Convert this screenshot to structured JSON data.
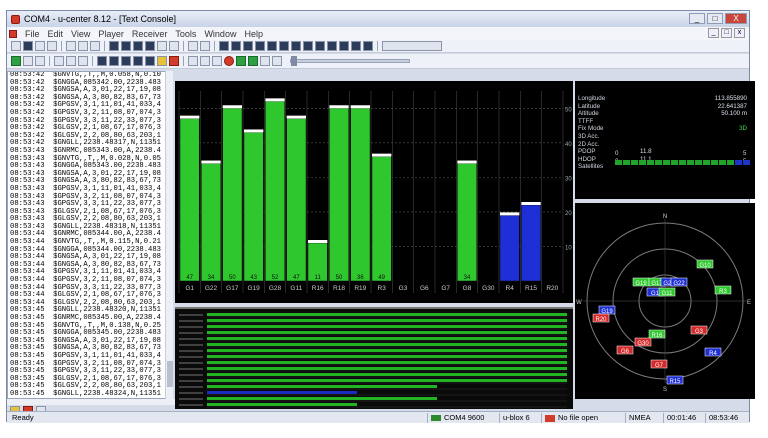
{
  "window": {
    "title": "COM4 - u-center 8.12 - [Text Console]",
    "buttons": [
      "_",
      "□",
      "X"
    ]
  },
  "menu": [
    "File",
    "Edit",
    "View",
    "Player",
    "Receiver",
    "Tools",
    "Window",
    "Help"
  ],
  "console_lines": [
    "08:53:42  $GNVTG,,T,,M,0.058,N,0.10",
    "08:53:42  $GNGGA,085342.00,2238.483",
    "08:53:42  $GNGSA,A,3,01,22,17,19,08",
    "08:53:42  $GNGSA,A,3,80,82,83,67,73",
    "08:53:42  $GPGSV,3,1,11,01,41,033,4",
    "08:53:42  $GPGSV,3,2,11,08,07,074,3",
    "08:53:42  $GPGSV,3,3,11,22,33,077,3",
    "08:53:42  $GLGSV,2,1,08,67,17,076,3",
    "08:53:42  $GLGSV,2,2,08,80,63,203,1",
    "08:53:42  $GNGLL,2238.48317,N,11351",
    "08:53:43  $GNRMC,085343.00,A,2238.4",
    "08:53:43  $GNVTG,,T,,M,0.028,N,0.05",
    "08:53:43  $GNGGA,085343.00,2238.483",
    "08:53:43  $GNGSA,A,3,01,22,17,19,08",
    "08:53:43  $GNGSA,A,3,80,82,83,67,73",
    "08:53:43  $GPGSV,3,1,11,01,41,033,4",
    "08:53:43  $GPGSV,3,2,11,08,07,074,3",
    "08:53:43  $GPGSV,3,3,11,22,33,077,3",
    "08:53:43  $GLGSV,2,1,08,67,17,076,3",
    "08:53:43  $GLGSV,2,2,08,80,63,203,1",
    "08:53:43  $GNGLL,2238.48318,N,11351",
    "08:53:44  $GNRMC,085344.00,A,2238.4",
    "08:53:44  $GNVTG,,T,,M,0.115,N,0.21",
    "08:53:44  $GNGGA,085344.00,2238.483",
    "08:53:44  $GNGSA,A,3,01,22,17,19,08",
    "08:53:44  $GNGSA,A,3,80,82,83,67,73",
    "08:53:44  $GPGSV,3,1,11,01,41,033,4",
    "08:53:44  $GPGSV,3,2,11,08,07,074,3",
    "08:53:44  $GPGSV,3,3,11,22,33,077,3",
    "08:53:44  $GLGSV,2,1,08,67,17,076,3",
    "08:53:44  $GLGSV,2,2,08,80,63,203,1",
    "08:53:45  $GNGLL,2238.48320,N,11351",
    "08:53:45  $GNRMC,085345.00,A,2238.4",
    "08:53:45  $GNVTG,,T,,M,0.138,N,0.25",
    "08:53:45  $GNGGA,085345.00,2238.483",
    "08:53:45  $GNGSA,A,3,01,22,17,19,08",
    "08:53:45  $GNGSA,A,3,80,82,83,67,73",
    "08:53:45  $GPGSV,3,1,11,01,41,033,4",
    "08:53:45  $GPGSV,3,2,11,08,07,074,3",
    "08:53:45  $GPGSV,3,3,11,22,33,077,3",
    "08:53:45  $GLGSV,2,1,08,67,17,076,3",
    "08:53:45  $GLGSV,2,2,08,80,63,203,1",
    "08:53:45  $GNGLL,2238.48324,N,11351"
  ],
  "chart_data": {
    "type": "bar",
    "categories": [
      "G1",
      "G22",
      "G17",
      "G19",
      "G28",
      "G11",
      "R16",
      "R18",
      "R19",
      "R3",
      "G3",
      "G6",
      "G7",
      "G8",
      "G30",
      "R4",
      "R15",
      "R20"
    ],
    "values": [
      47,
      34,
      50,
      43,
      52,
      47,
      11,
      50,
      50,
      36,
      0,
      0,
      0,
      34,
      0,
      19,
      22,
      0
    ],
    "data_labels": [
      "47",
      "34",
      "50",
      "43",
      "52",
      "47",
      "11",
      "50",
      "36",
      "49",
      "",
      "",
      "",
      "34",
      "",
      "",
      "",
      ""
    ],
    "series_colors": {
      "used": "#2ec82e",
      "not_used": "#1e2fd6"
    },
    "colors": [
      "used",
      "used",
      "used",
      "used",
      "used",
      "used",
      "used",
      "used",
      "used",
      "used",
      "used",
      "used",
      "used",
      "used",
      "used",
      "not_used",
      "not_used",
      "used"
    ],
    "ylim": [
      0,
      55
    ],
    "yticks": [
      "50",
      "40",
      "30",
      "20",
      "10"
    ],
    "grid": true
  },
  "dataview": {
    "rows": [
      {
        "label": "Longitude",
        "value": "113.855890"
      },
      {
        "label": "Latitude",
        "value": "22.641387"
      },
      {
        "label": "Altitude",
        "value": "50.100 m"
      },
      {
        "label": "TTFF",
        "value": ""
      },
      {
        "label": "Fix Mode",
        "value": "3D"
      },
      {
        "label": "3D Acc.",
        "value": ""
      },
      {
        "label": "2D Acc.",
        "value": ""
      },
      {
        "label": "PDOP",
        "value": "11.8"
      },
      {
        "label": "HDOP",
        "value": "11.1"
      },
      {
        "label": "Satellites",
        "value": ""
      }
    ],
    "pdop_scale": [
      "0",
      "5"
    ],
    "hdop_scale": [
      "0",
      "5"
    ]
  },
  "skyview": {
    "compass": [
      "N",
      "E",
      "S",
      "W"
    ],
    "satellites": [
      {
        "id": "G10",
        "color": "#2ec82e"
      },
      {
        "id": "G19",
        "color": "#2ec82e"
      },
      {
        "id": "G17",
        "color": "#2ec82e"
      },
      {
        "id": "G28",
        "color": "#1e2fd6"
      },
      {
        "id": "G1",
        "color": "#1e2fd6"
      },
      {
        "id": "G11",
        "color": "#2ec82e"
      },
      {
        "id": "G22",
        "color": "#1e2fd6"
      },
      {
        "id": "R3",
        "color": "#2ec82e"
      },
      {
        "id": "G19",
        "color": "#1e2fd6"
      },
      {
        "id": "R20",
        "color": "#d52a2a"
      },
      {
        "id": "R16",
        "color": "#2ec82e"
      },
      {
        "id": "G30",
        "color": "#d52a2a"
      },
      {
        "id": "G3",
        "color": "#d52a2a"
      },
      {
        "id": "G6",
        "color": "#d52a2a"
      },
      {
        "id": "R4",
        "color": "#1e2fd6"
      },
      {
        "id": "G7",
        "color": "#d52a2a"
      },
      {
        "id": "R15",
        "color": "#1e2fd6"
      }
    ]
  },
  "status": {
    "ready": "Ready",
    "port": "COM4 9600",
    "receiver": "u-blox 6",
    "file": "No file open",
    "protocol": "NMEA",
    "elapsed": "00:01:46",
    "clock": "08:53:46"
  },
  "colors": {
    "bg_dark": "#000000",
    "chrome": "#d6dbe9",
    "accent_green": "#2ec82e"
  }
}
